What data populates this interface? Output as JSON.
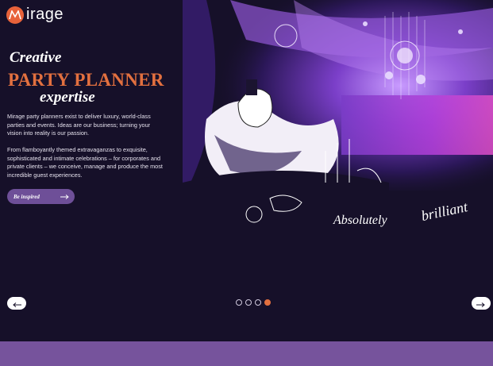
{
  "brand": {
    "name": "irage",
    "logo_icon": "mirage-m-logo",
    "accent": "#e2703f"
  },
  "hero": {
    "heading_line1": "Creative",
    "heading_line2": "PARTY PLANNER",
    "heading_line3": "expertise",
    "paragraph1": "Mirage party planners exist to deliver luxury, world-class parties and events. Ideas are our business; turning your vision into reality is our passion.",
    "paragraph2": "From flamboyantly themed extravaganzas to exquisite, sophisticated and intimate celebrations – for corporates and private clients – we conceive, manage and produce the most incredible guest experiences.",
    "cta_label": "Be inspired",
    "cta_icon": "arrow-right-icon",
    "art_script_word1": "Absolutely",
    "art_script_word2": "brilliant"
  },
  "carousel": {
    "prev_icon": "arrow-left-icon",
    "next_icon": "arrow-right-icon",
    "slide_count": 4,
    "active_slide": 4
  },
  "colors": {
    "background": "#161029",
    "band": "#76539c",
    "button": "#6e4f98"
  }
}
